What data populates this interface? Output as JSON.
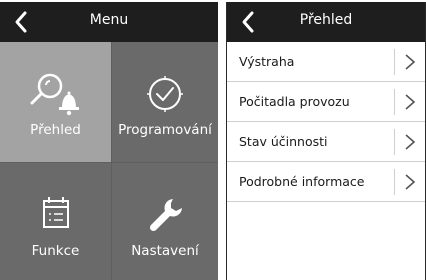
{
  "left_screen": {
    "title": "Menu",
    "tiles": [
      {
        "label": "Přehled",
        "icon": "search-bell-icon"
      },
      {
        "label": "Programování",
        "icon": "clock-check-icon"
      },
      {
        "label": "Funkce",
        "icon": "calendar-list-icon"
      },
      {
        "label": "Nastavení",
        "icon": "wrench-icon"
      }
    ]
  },
  "right_screen": {
    "title": "Přehled",
    "items": [
      {
        "label": "Výstraha"
      },
      {
        "label": "Počitadla provozu"
      },
      {
        "label": "Stav účinnosti"
      },
      {
        "label": "Podrobné informace"
      }
    ]
  },
  "colors": {
    "topbar": "#1e1e1e",
    "tile_selected": "#a3a3a3",
    "tile": "#6a6a6b",
    "background": "#5f5f60"
  }
}
